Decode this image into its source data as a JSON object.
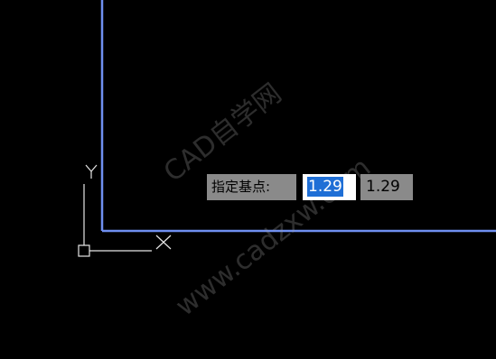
{
  "drawing": {
    "border_color": "#6f8ff0",
    "ucs_color": "#e6e6e6",
    "ucs_y_label": "Y",
    "ucs_x_label": "X"
  },
  "dynamic_input": {
    "prompt_label": "指定基点:",
    "x_value": "1.29",
    "y_value": "1.29",
    "selection_color": "#1f6fd6"
  },
  "watermark": {
    "line1": "CAD自学网",
    "line2": "www.cadzxw.com"
  }
}
